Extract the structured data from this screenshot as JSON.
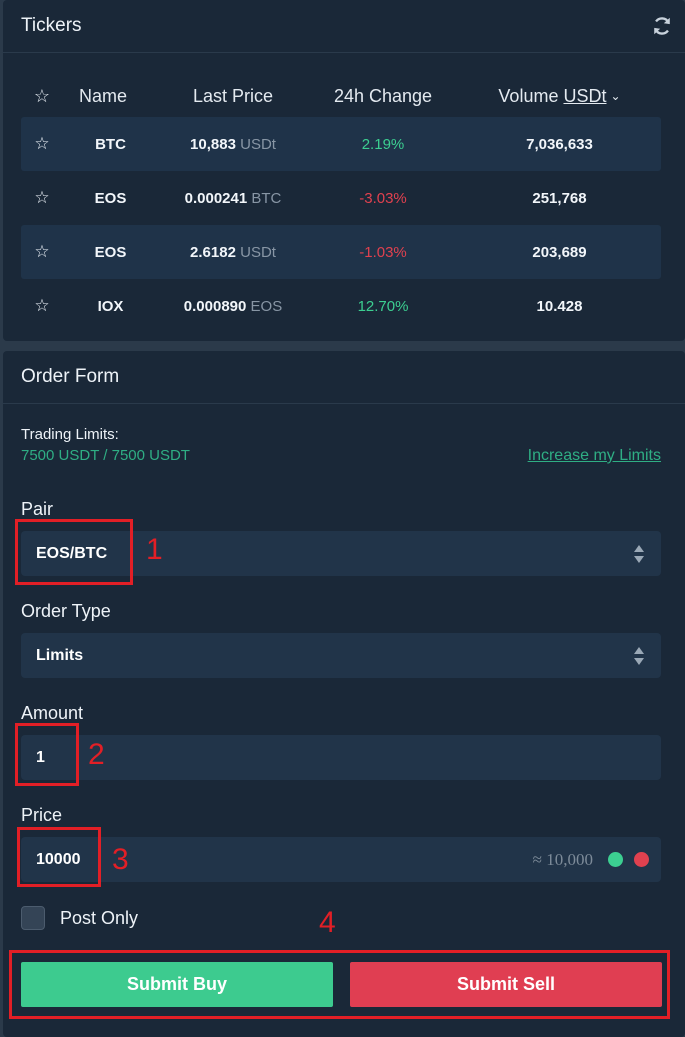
{
  "tickers": {
    "title": "Tickers",
    "refresh_icon": "refresh-icon",
    "headers": {
      "star": "☆",
      "name": "Name",
      "last_price": "Last Price",
      "change": "24h Change",
      "volume": "Volume",
      "volume_unit": "USDt",
      "volume_chevron": "⌄"
    },
    "rows": [
      {
        "name": "BTC",
        "price": "10,883",
        "unit": "USDt",
        "change": "2.19%",
        "direction": "up",
        "volume": "7,036,633"
      },
      {
        "name": "EOS",
        "price": "0.000241",
        "unit": "BTC",
        "change": "-3.03%",
        "direction": "down",
        "volume": "251,768"
      },
      {
        "name": "EOS",
        "price": "2.6182",
        "unit": "USDt",
        "change": "-1.03%",
        "direction": "down",
        "volume": "203,689"
      },
      {
        "name": "IOX",
        "price": "0.000890",
        "unit": "EOS",
        "change": "12.70%",
        "direction": "up",
        "volume": "10.428"
      }
    ]
  },
  "order_form": {
    "title": "Order Form",
    "trading_limits_label": "Trading Limits:",
    "trading_limits_value": "7500 USDT / 7500 USDT",
    "increase_limits_link": "Increase my Limits",
    "pair": {
      "label": "Pair",
      "value": "EOS/BTC"
    },
    "order_type": {
      "label": "Order Type",
      "value": "Limits"
    },
    "amount": {
      "label": "Amount",
      "value": "1"
    },
    "price": {
      "label": "Price",
      "value": "10000",
      "approx": "≈ 10,000"
    },
    "post_only": {
      "label": "Post Only",
      "checked": false
    },
    "submit_buy": "Submit Buy",
    "submit_sell": "Submit Sell"
  },
  "annotations": [
    "1",
    "2",
    "3",
    "4"
  ],
  "colors": {
    "positive": "#3ccf91",
    "negative": "#e0414f",
    "accent_link": "#2fae84",
    "annotation": "#e21f26"
  }
}
